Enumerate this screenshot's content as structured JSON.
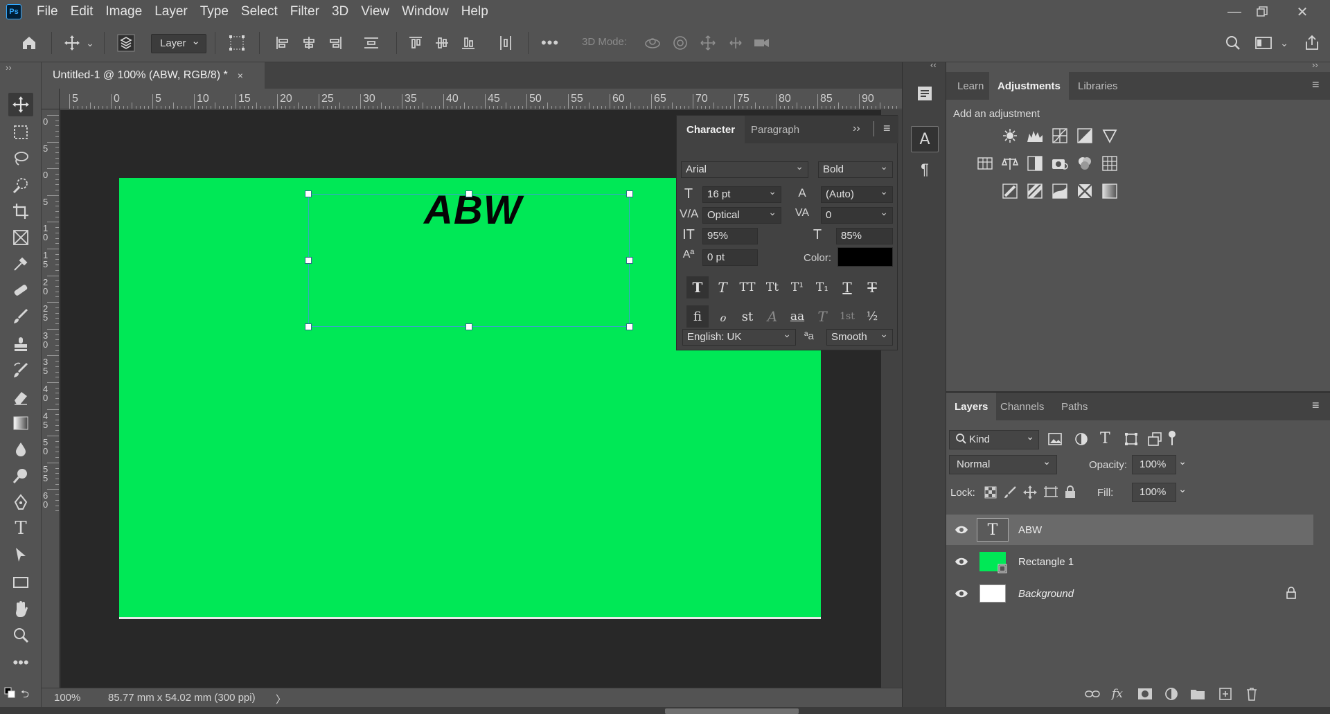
{
  "app": {
    "logo": "Ps"
  },
  "menu": [
    "File",
    "Edit",
    "Image",
    "Layer",
    "Type",
    "Select",
    "Filter",
    "3D",
    "View",
    "Window",
    "Help"
  ],
  "options_bar": {
    "auto_select_target": "Layer",
    "mode_3d_label": "3D Mode:"
  },
  "document": {
    "tab_title": "Untitled-1 @ 100% (ABW, RGB/8) *",
    "close_glyph": "×",
    "text_content": "ABW",
    "canvas_color": "#00e856",
    "ruler_h_labels": [
      "5",
      "0",
      "5",
      "10",
      "15",
      "20",
      "25",
      "30",
      "35",
      "40",
      "45",
      "50",
      "55",
      "60",
      "65",
      "70",
      "75",
      "80",
      "85",
      "90"
    ],
    "ruler_v_labels": [
      "0",
      "5",
      "0",
      "5",
      "1 0",
      "1 5",
      "2 0",
      "2 5",
      "3 0",
      "3 5",
      "4 0",
      "4 5",
      "5 0",
      "5 5",
      "6 0"
    ]
  },
  "status": {
    "zoom": "100%",
    "doc_info": "85.77 mm x 54.02 mm (300 ppi)",
    "arrow": "〉"
  },
  "character_panel": {
    "tabs": [
      "Character",
      "Paragraph"
    ],
    "active_tab": "Character",
    "font_family": "Arial",
    "font_style": "Bold",
    "font_size": "16 pt",
    "leading": "(Auto)",
    "kerning": "Optical",
    "tracking": "0",
    "vertical_scale": "95%",
    "horizontal_scale": "85%",
    "baseline_shift": "0 pt",
    "color_label": "Color:",
    "text_color": "#000000",
    "language": "English: UK",
    "antialias": "Smooth",
    "aa_icon": "ªa",
    "style_buttons_row1": [
      "T",
      "T",
      "TT",
      "Tt",
      "T¹",
      "T₁",
      "T",
      "T"
    ],
    "style_buttons_row2": [
      "fi",
      "ℴ",
      "st",
      "A",
      "aa",
      "T",
      "1st",
      "½"
    ]
  },
  "right_panels": {
    "top_tabs": [
      "Learn",
      "Adjustments",
      "Libraries"
    ],
    "top_active": "Adjustments",
    "adjustment_hint": "Add an adjustment",
    "layers_tabs": [
      "Layers",
      "Channels",
      "Paths"
    ],
    "layers_active": "Layers",
    "filter_kind": "Kind",
    "blend_mode": "Normal",
    "opacity_label": "Opacity:",
    "opacity": "100%",
    "lock_label": "Lock:",
    "fill_label": "Fill:",
    "fill": "100%",
    "layers": [
      {
        "name": "ABW",
        "type": "text",
        "selected": true
      },
      {
        "name": "Rectangle 1",
        "type": "shape",
        "selected": false
      },
      {
        "name": "Background",
        "type": "background",
        "selected": false
      }
    ]
  }
}
